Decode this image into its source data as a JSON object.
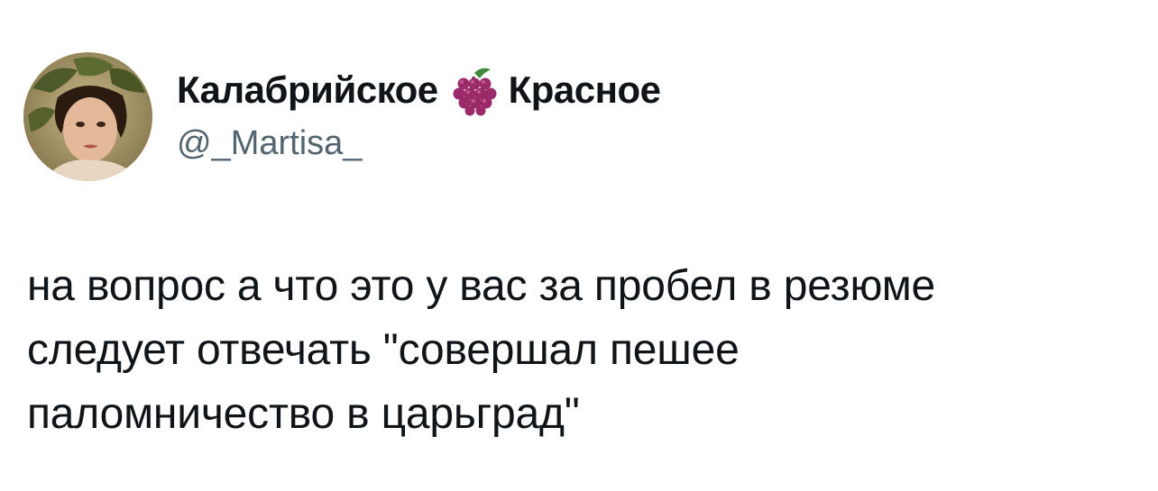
{
  "tweet": {
    "author": {
      "display_name_part1": "Калабрийское",
      "display_name_emoji": "grapes-icon",
      "display_name_part2": "Красное",
      "handle": "@_Martisa_"
    },
    "text_lines": [
      "на вопрос а что это у вас за пробел в резюме",
      "следует отвечать \"совершал пешее",
      "паломничество в царьград\""
    ]
  },
  "colors": {
    "text_primary": "#0f1419",
    "text_secondary": "#536471",
    "background": "#ffffff",
    "grape": "#9b2a6a"
  }
}
